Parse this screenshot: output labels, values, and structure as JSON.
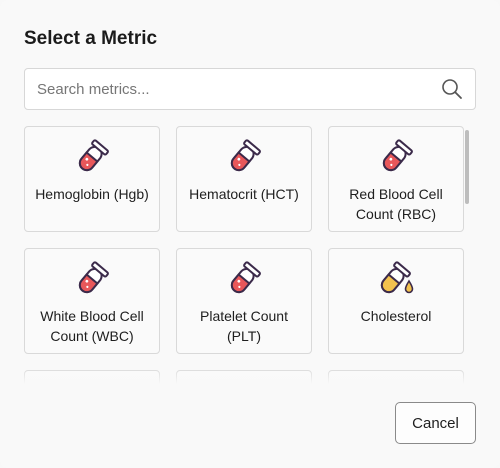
{
  "dialog": {
    "title": "Select a Metric",
    "search": {
      "placeholder": "Search metrics...",
      "value": "",
      "icon": "search-icon"
    },
    "metrics": [
      {
        "label": "Hemoglobin (Hgb)",
        "icon": "test-tube-red-icon"
      },
      {
        "label": "Hematocrit (HCT)",
        "icon": "test-tube-red-icon"
      },
      {
        "label": "Red Blood Cell Count (RBC)",
        "icon": "test-tube-red-icon"
      },
      {
        "label": "White Blood Cell Count (WBC)",
        "icon": "test-tube-red-icon"
      },
      {
        "label": "Platelet Count (PLT)",
        "icon": "test-tube-red-icon"
      },
      {
        "label": "Cholesterol",
        "icon": "test-tube-yellow-drop-icon"
      },
      {
        "label": "",
        "icon": ""
      },
      {
        "label": "",
        "icon": ""
      },
      {
        "label": "",
        "icon": ""
      }
    ],
    "cancel_label": "Cancel"
  },
  "colors": {
    "tube_red": "#e8575a",
    "tube_yellow": "#f2c14e",
    "tube_outline": "#3b2a4a"
  }
}
